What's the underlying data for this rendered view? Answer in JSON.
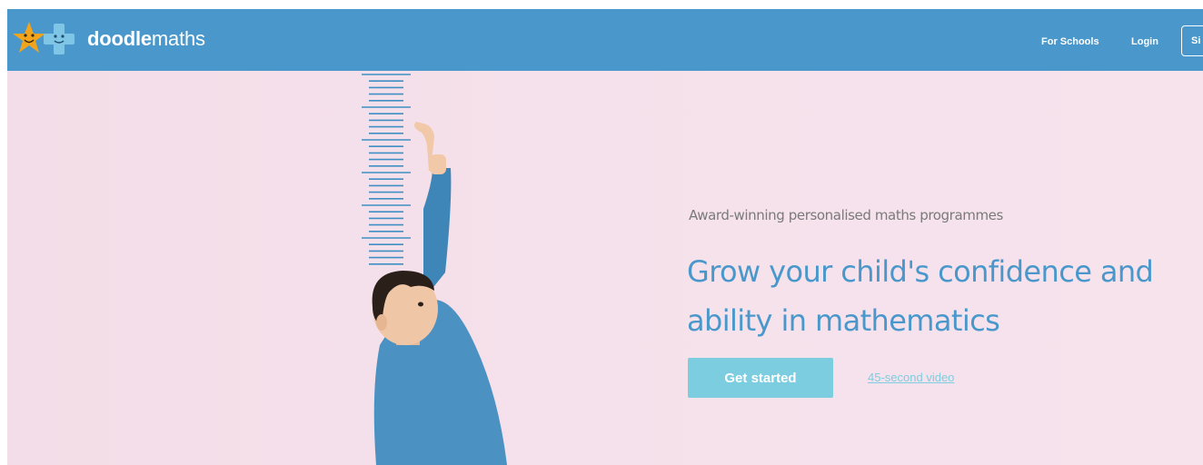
{
  "brand": {
    "name_bold": "doodle",
    "name_light": "maths",
    "logo_icon": "star-and-plus-mascot-icon"
  },
  "nav": {
    "for_schools": "For Schools",
    "login": "Login",
    "signup_partial": "Si"
  },
  "hero": {
    "tagline": "Award-winning personalised maths programmes",
    "headline": "Grow your child's confidence and ability in mathematics",
    "cta_label": "Get started",
    "video_link": "45-second video",
    "image_description_icon": "child-measuring-height-image"
  },
  "colors": {
    "navbar": "#4a98cb",
    "headline": "#4a98cb",
    "cta": "#7dcde1",
    "background": "#f5e1eb",
    "ruler": "#3f8fc4"
  }
}
